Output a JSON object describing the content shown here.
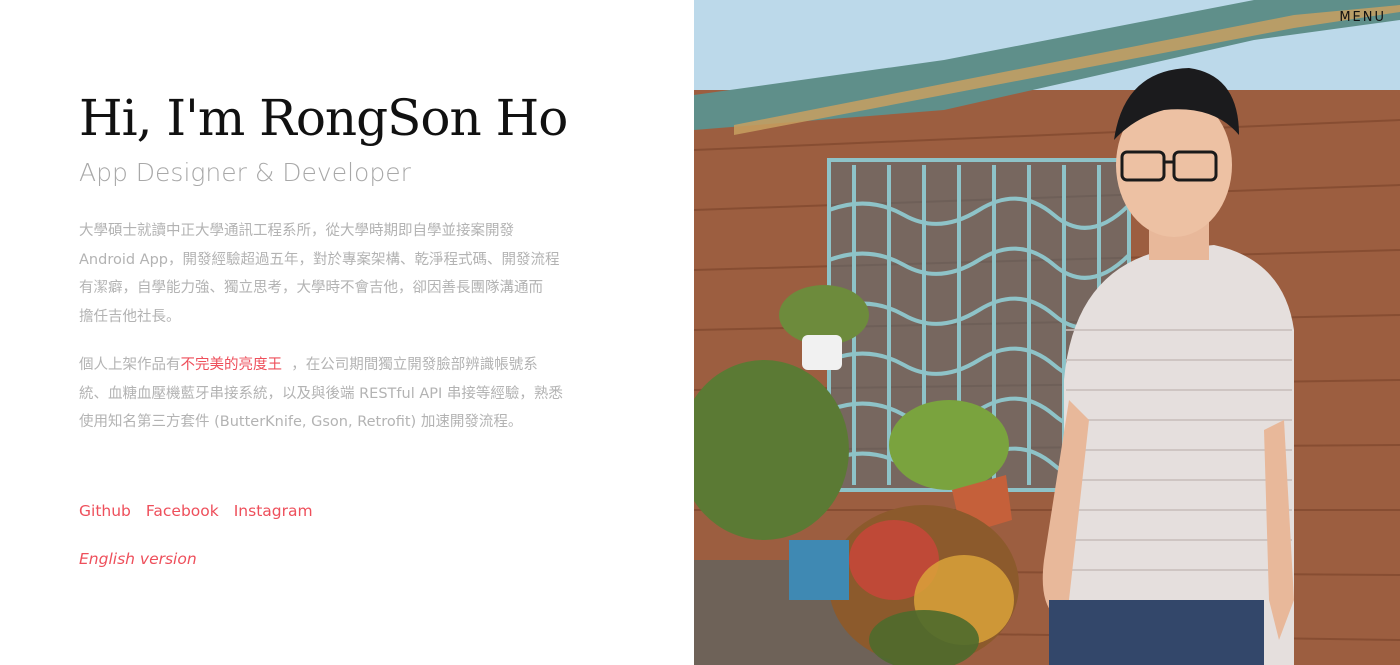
{
  "header": {
    "title": "Hi, I'm RongSon Ho",
    "subtitle": "App Designer & Developer"
  },
  "about": {
    "paragraph1_lines": [
      "大學碩士就讀中正大學通訊工程系所，從大學時期即自學並接案開發",
      "Android App，開發經驗超過五年，對於專案架構、乾淨程式碼、開發流程",
      "有潔癖，自學能力強、獨立思考，大學時不會吉他，卻因善長團隊溝通而",
      "擔任吉他社長。"
    ],
    "paragraph2_prefix": "個人上架作品有",
    "paragraph2_link": "不完美的亮度王",
    "paragraph2_line1_suffix": "，在公司期間獨立開發臉部辨識帳號系",
    "paragraph2_lines": [
      "統、血糖血壓機藍牙串接系統，以及與後端 RESTful API 串接等經驗，熟悉",
      "使用知名第三方套件 (ButterKnife, Gson, Retrofit) 加速開發流程。"
    ]
  },
  "social": {
    "github": "Github",
    "facebook": "Facebook",
    "instagram": "Instagram"
  },
  "language_link": "English version",
  "nav": {
    "menu_label": "MENU"
  },
  "colors": {
    "accent": "#ee4f5b",
    "title": "#111111",
    "subtitle": "#a8a8a8",
    "body_text": "#b3b3b3"
  }
}
